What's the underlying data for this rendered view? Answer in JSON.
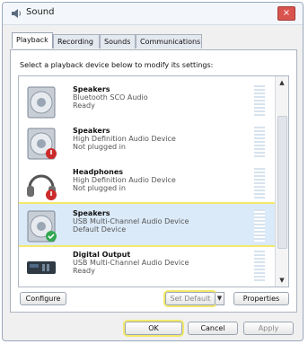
{
  "window": {
    "title": "Sound",
    "icon": "speaker-icon",
    "close_label": "×"
  },
  "tabs": [
    {
      "label": "Playback",
      "active": true
    },
    {
      "label": "Recording",
      "active": false
    },
    {
      "label": "Sounds",
      "active": false
    },
    {
      "label": "Communications",
      "active": false
    }
  ],
  "panel": {
    "instruction": "Select a playback device below to modify its settings:"
  },
  "devices": [
    {
      "name": "Speakers",
      "description": "Bluetooth SCO Audio",
      "status": "Ready",
      "icon": "speaker-icon",
      "badge": ""
    },
    {
      "name": "Speakers",
      "description": "High Definition Audio Device",
      "status": "Not plugged in",
      "icon": "speaker-icon",
      "badge": "unplugged-badge"
    },
    {
      "name": "Headphones",
      "description": "High Definition Audio Device",
      "status": "Not plugged in",
      "icon": "headphones-icon",
      "badge": "unplugged-badge"
    },
    {
      "name": "Speakers",
      "description": "USB Multi-Channel Audio Device",
      "status": "Default Device",
      "icon": "speaker-icon",
      "badge": "default-check-badge",
      "selected": true
    },
    {
      "name": "Digital Output",
      "description": "USB Multi-Channel Audio Device",
      "status": "Ready",
      "icon": "digital-output-icon",
      "badge": ""
    }
  ],
  "buttons": {
    "configure": "Configure",
    "set_default": "Set Default",
    "properties": "Properties",
    "ok": "OK",
    "cancel": "Cancel",
    "apply": "Apply"
  },
  "colors": {
    "highlight": "#f3e96b",
    "selected_row": "#dbeaf8",
    "close_button": "#d9534f",
    "default_check": "#33a852",
    "unplugged_badge": "#cc2b2b"
  }
}
